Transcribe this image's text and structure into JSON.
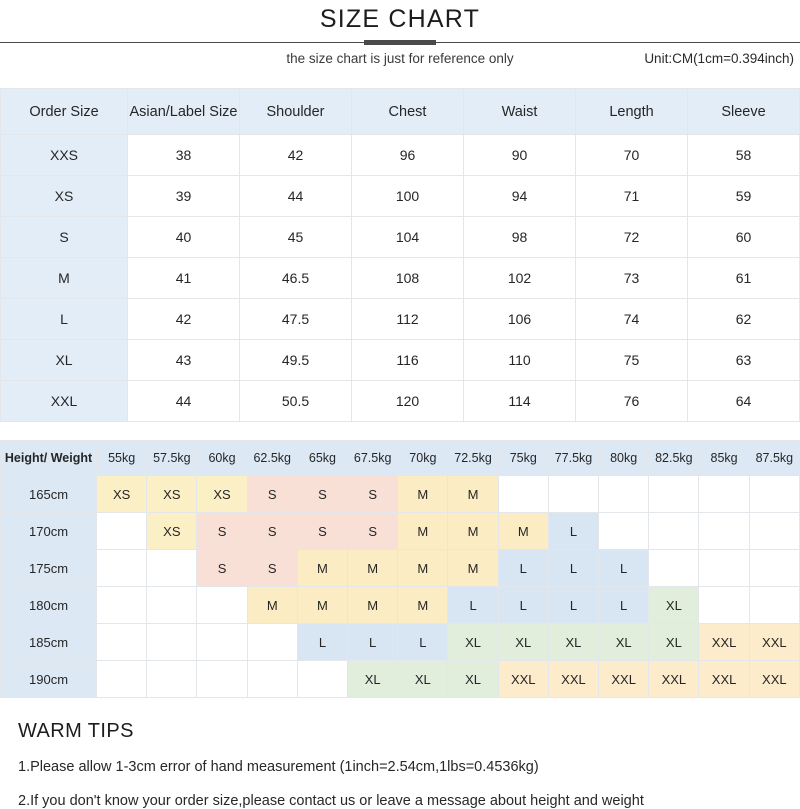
{
  "header": {
    "title": "SIZE CHART",
    "subtitle": "the size chart is just for reference only",
    "unit_note": "Unit:CM(1cm=0.394inch)"
  },
  "size_table": {
    "columns": [
      "Order Size",
      "Asian/Label Size",
      "Shoulder",
      "Chest",
      "Waist",
      "Length",
      "Sleeve"
    ],
    "rows": [
      {
        "order": "XXS",
        "asian": "38",
        "shoulder": "42",
        "chest": "96",
        "waist": "90",
        "length": "70",
        "sleeve": "58"
      },
      {
        "order": "XS",
        "asian": "39",
        "shoulder": "44",
        "chest": "100",
        "waist": "94",
        "length": "71",
        "sleeve": "59"
      },
      {
        "order": "S",
        "asian": "40",
        "shoulder": "45",
        "chest": "104",
        "waist": "98",
        "length": "72",
        "sleeve": "60"
      },
      {
        "order": "M",
        "asian": "41",
        "shoulder": "46.5",
        "chest": "108",
        "waist": "102",
        "length": "73",
        "sleeve": "61"
      },
      {
        "order": "L",
        "asian": "42",
        "shoulder": "47.5",
        "chest": "112",
        "waist": "106",
        "length": "74",
        "sleeve": "62"
      },
      {
        "order": "XL",
        "asian": "43",
        "shoulder": "49.5",
        "chest": "116",
        "waist": "110",
        "length": "75",
        "sleeve": "63"
      },
      {
        "order": "XXL",
        "asian": "44",
        "shoulder": "50.5",
        "chest": "120",
        "waist": "114",
        "length": "76",
        "sleeve": "64"
      }
    ]
  },
  "hw_table": {
    "corner_label": "Height/ Weight",
    "weights": [
      "55kg",
      "57.5kg",
      "60kg",
      "62.5kg",
      "65kg",
      "67.5kg",
      "70kg",
      "72.5kg",
      "75kg",
      "77.5kg",
      "80kg",
      "82.5kg",
      "85kg",
      "87.5kg"
    ],
    "heights": [
      "165cm",
      "170cm",
      "175cm",
      "180cm",
      "185cm",
      "190cm"
    ],
    "matrix": [
      [
        "XS",
        "XS",
        "XS",
        "S",
        "S",
        "S",
        "M",
        "M",
        "",
        "",
        "",
        "",
        "",
        ""
      ],
      [
        "",
        "XS",
        "S",
        "S",
        "S",
        "S",
        "M",
        "M",
        "M",
        "L",
        "",
        "",
        "",
        ""
      ],
      [
        "",
        "",
        "S",
        "S",
        "M",
        "M",
        "M",
        "M",
        "L",
        "L",
        "L",
        "",
        "",
        ""
      ],
      [
        "",
        "",
        "",
        "M",
        "M",
        "M",
        "M",
        "L",
        "L",
        "L",
        "L",
        "XL",
        "",
        ""
      ],
      [
        "",
        "",
        "",
        "",
        "L",
        "L",
        "L",
        "XL",
        "XL",
        "XL",
        "XL",
        "XL",
        "XXL",
        "XXL"
      ],
      [
        "",
        "",
        "",
        "",
        "",
        "XL",
        "XL",
        "XL",
        "XXL",
        "XXL",
        "XXL",
        "XXL",
        "XXL",
        "XXL"
      ]
    ]
  },
  "colors": {
    "header_blue": "#e3edf7",
    "matrix_header_blue": "#dde8f5",
    "XS": "#fbefc6",
    "S": "#f9e0d7",
    "M": "#fcecc3",
    "L": "#d8e6f4",
    "XL": "#e1eedb",
    "XXL": "#fdeccc"
  },
  "tips": {
    "title": "WARM TIPS",
    "lines": [
      "1.Please allow 1-3cm error of hand measurement (1inch=2.54cm,1lbs=0.4536kg)",
      "2.If you don't know your order size,please contact us or leave a message about height and weight"
    ]
  }
}
